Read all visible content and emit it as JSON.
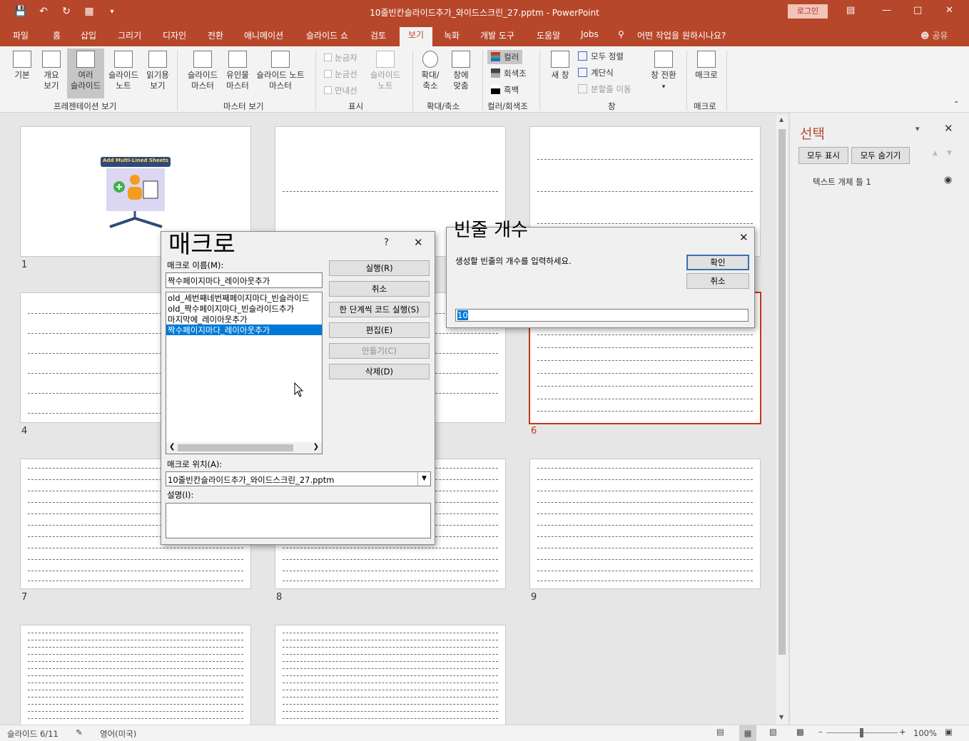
{
  "window": {
    "title": "10줄빈칸슬라이드추가_와이드스크린_27.pptm  -  PowerPoint",
    "login": "로그인"
  },
  "tabs": [
    "파일",
    "홈",
    "삽입",
    "그리기",
    "디자인",
    "전환",
    "애니메이션",
    "슬라이드 쇼",
    "검토",
    "보기",
    "녹화",
    "개발 도구",
    "도움말",
    "Jobs"
  ],
  "active_tab": "보기",
  "tellme": "어떤 작업을 원하시나요?",
  "share": "공유",
  "ribbon": {
    "pres_view": {
      "basic": "기본",
      "outline": "개요\n보기",
      "sorter": "여러\n슬라이드",
      "notes": "슬라이드\n노트",
      "reading": "읽기용\n보기",
      "label": "프레젠테이션 보기"
    },
    "master": {
      "slide": "슬라이드\n마스터",
      "handout": "유인물\n마스터",
      "notes": "슬라이드 노트\n마스터",
      "label": "마스터 보기"
    },
    "show": {
      "ruler": "눈금자",
      "grid": "눈금선",
      "guides": "안내선",
      "notes": "슬라이드\n노트",
      "label": "표시"
    },
    "zoom": {
      "zoom": "확대/\n축소",
      "fit": "창에\n맞춤",
      "label": "확대/축소"
    },
    "color": {
      "color": "컬러",
      "gray": "회색조",
      "bw": "흑백",
      "label": "컬러/회색조"
    },
    "window": {
      "new": "새 창",
      "arrange": "모두 정렬",
      "cascade": "계단식",
      "split": "분할줄 이동",
      "switch": "창 전환",
      "label": "창"
    },
    "macros": {
      "macros": "매크로",
      "label": "매크로"
    }
  },
  "slides": {
    "numbers": [
      "1",
      "4",
      "6",
      "7",
      "8",
      "9"
    ],
    "slide1_banner": "Add Multi-Lined Sheets"
  },
  "selection_pane": {
    "title": "선택",
    "show_all": "모두 표시",
    "hide_all": "모두 숨기기",
    "item": "텍스트 개체 틀 1"
  },
  "status": {
    "slide": "슬라이드 6/11",
    "lang": "영어(미국)",
    "zoom": "100%"
  },
  "macro_dialog": {
    "title": "매크로",
    "help": "?",
    "name_label": "매크로 이름(M):",
    "name_value": "짝수페이지마다_레이아웃추가",
    "list": [
      "old_세번째네번째페이지마다_빈슬라이드",
      "old_짝수페이지마다_빈슬라이드추가",
      "마지막에_레이아웃추가",
      "짝수페이지마다_레이아웃추가"
    ],
    "selected_index": 3,
    "buttons": {
      "run": "실행(R)",
      "cancel": "취소",
      "step": "한 단계씩 코드 실행(S)",
      "edit": "편집(E)",
      "create": "만들기(C)",
      "delete": "삭제(D)"
    },
    "loc_label": "매크로 위치(A):",
    "loc_value": "10줄빈칸슬라이드추가_와이드스크린_27.pptm",
    "desc_label": "설명(I):"
  },
  "input_dialog": {
    "title": "빈줄 개수",
    "prompt": "생성할 빈줄의 개수를 입력하세요.",
    "ok": "확인",
    "cancel": "취소",
    "value": "10"
  }
}
